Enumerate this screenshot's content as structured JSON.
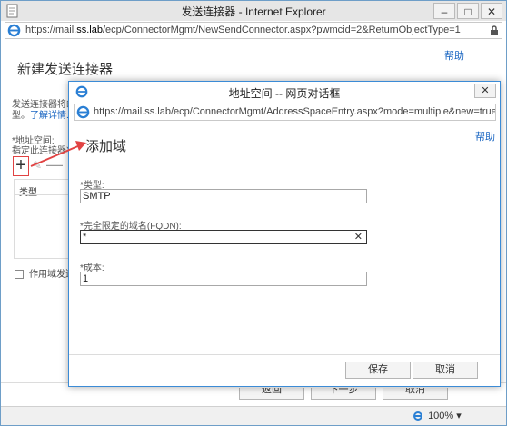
{
  "window": {
    "title": "发送连接器 - Internet Explorer",
    "url_prefix": "https://mail.",
    "url_host": "ss.lab",
    "url_rest": "/ecp/ConnectorMgmt/NewSendConnector.aspx?pwmcid=2&ReturnObjectType=1",
    "min_glyph": "–",
    "max_glyph": "□",
    "close_glyph": "✕"
  },
  "page": {
    "help": "帮助",
    "title": "新建发送连接器",
    "desc_line1": "发送连接器将邮",
    "desc_line2": "型。",
    "learn_more": "了解详情...",
    "address_space_label": "*地址空间:",
    "specify_label": "指定此连接器将",
    "add_glyph": "+",
    "edit_glyph": "✎",
    "remove_glyph": "—",
    "grid_header": "类型",
    "scope_checkbox_label": "作用域发送",
    "back_button": "返回",
    "next_button": "下一步",
    "cancel_button": "取消"
  },
  "statusbar": {
    "zoom": "100%"
  },
  "dialog": {
    "title": "地址空间 -- 网页对话框",
    "close_glyph": "✕",
    "url_prefix": "https://mail.",
    "url_host": "ss.lab",
    "url_rest": "/ecp/ConnectorMgmt/AddressSpaceEntry.aspx?mode=multiple&new=true&title=PWT",
    "help": "帮助",
    "heading": "添加域",
    "type_label": "*类型:",
    "type_value": "SMTP",
    "fqdn_label": "*完全限定的域名(FQDN):",
    "fqdn_value": "*",
    "fqdn_clear": "✕",
    "cost_label": "*成本:",
    "cost_value": "1",
    "save_button": "保存",
    "cancel_button": "取消"
  },
  "colors": {
    "annotation": "#e14343",
    "link": "#1a66c2",
    "dialog_border": "#3b8bd6"
  }
}
